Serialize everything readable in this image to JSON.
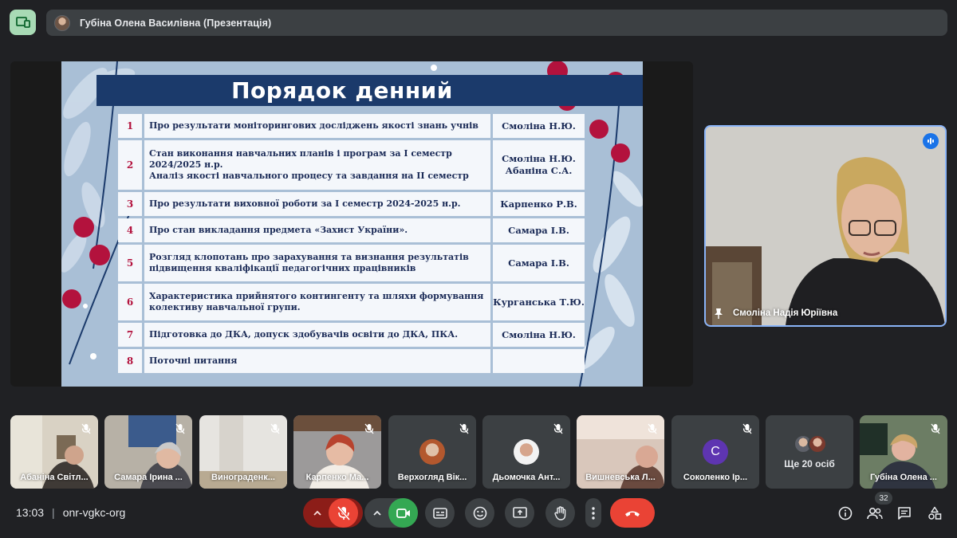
{
  "presenter": {
    "title": "Губіна Олена Василівна (Презентація)"
  },
  "slide": {
    "title": "Порядок денний",
    "rows": [
      {
        "num": "1",
        "topic": [
          "Про результати моніторингових досліджень якості знань учнів"
        ],
        "resp": [
          "Смоліна Н.Ю."
        ]
      },
      {
        "num": "2",
        "topic": [
          "Стан виконання навчальних планів і програм за І семестр",
          "2024/2025 н.р.",
          "Аналіз якості навчального процесу та завдання на ІІ семестр"
        ],
        "resp": [
          "Смоліна Н.Ю.",
          "Абаніна С.А."
        ]
      },
      {
        "num": "3",
        "topic": [
          "Про результати  виховної роботи за І семестр  2024-2025 н.р."
        ],
        "resp": [
          "Карпенко Р.В."
        ]
      },
      {
        "num": "4",
        "topic": [
          "Про стан викладання предмета «Захист України»."
        ],
        "resp": [
          "Самара І.В."
        ]
      },
      {
        "num": "5",
        "topic": [
          "Розгляд клопотань про зарахування та визнання результатів",
          "підвищення кваліфікації педагогічних працівників"
        ],
        "resp": [
          "Самара І.В."
        ]
      },
      {
        "num": "6",
        "topic": [
          "Характеристика прийнятого контингенту та шляхи формування",
          "колективу навчальної групи."
        ],
        "resp": [
          "Курганська Т.Ю."
        ]
      },
      {
        "num": "7",
        "topic": [
          "Підготовка до ДКА, допуск здобувачів освіти до ДКА, ПКА."
        ],
        "resp": [
          "Смоліна Н.Ю."
        ]
      },
      {
        "num": "8",
        "topic": [
          "Поточні питання"
        ],
        "resp": [
          ""
        ]
      }
    ]
  },
  "pinned": {
    "name": "Смоліна Надія Юріївна"
  },
  "participants": [
    {
      "name": "Абаніна Світл...",
      "kind": "video"
    },
    {
      "name": "Самара Ірина ...",
      "kind": "video"
    },
    {
      "name": "Винограденк...",
      "kind": "video"
    },
    {
      "name": "Карпенко Ма...",
      "kind": "video"
    },
    {
      "name": "Верхогляд Вік...",
      "kind": "avatar"
    },
    {
      "name": "Дьомочка Ант...",
      "kind": "avatar"
    },
    {
      "name": "Вишневська Л...",
      "kind": "video"
    },
    {
      "name": "Соколенко Ір...",
      "kind": "letter",
      "letter": "С"
    },
    {
      "name": "Губіна Олена ...",
      "kind": "video"
    }
  ],
  "more": {
    "label": "Ще 20 осіб"
  },
  "meeting": {
    "time": "13:03",
    "code": "onr-vgkc-org",
    "people_count": "32"
  },
  "colors": {
    "mic_off": "#ea4335",
    "camera_on": "#34a853",
    "hangup": "#ea4335",
    "accent": "#8ab4f8"
  }
}
